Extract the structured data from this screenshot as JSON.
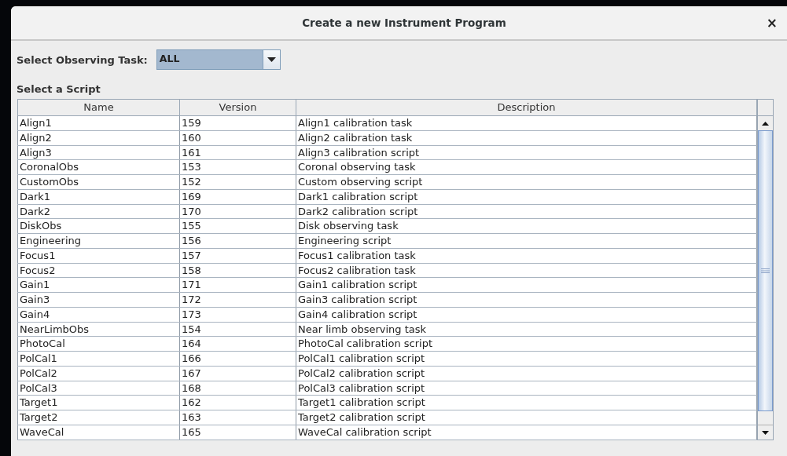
{
  "window": {
    "title": "Create a new Instrument Program",
    "close": "×"
  },
  "task": {
    "label": "Select Observing Task:",
    "value": "ALL"
  },
  "table": {
    "title": "Select a Script",
    "columns": [
      "Name",
      "Version",
      "Description"
    ],
    "rows": [
      [
        "Align1",
        "159",
        "Align1 calibration task"
      ],
      [
        "Align2",
        "160",
        "Align2 calibration task"
      ],
      [
        "Align3",
        "161",
        "Align3 calibration script"
      ],
      [
        "CoronalObs",
        "153",
        "Coronal observing task"
      ],
      [
        "CustomObs",
        "152",
        "Custom observing script"
      ],
      [
        "Dark1",
        "169",
        "Dark1 calibration script"
      ],
      [
        "Dark2",
        "170",
        "Dark2 calibration script"
      ],
      [
        "DiskObs",
        "155",
        "Disk observing task"
      ],
      [
        "Engineering",
        "156",
        "Engineering script"
      ],
      [
        "Focus1",
        "157",
        "Focus1 calibration task"
      ],
      [
        "Focus2",
        "158",
        "Focus2 calibration task"
      ],
      [
        "Gain1",
        "171",
        "Gain1 calibration script"
      ],
      [
        "Gain3",
        "172",
        "Gain3 calibration script"
      ],
      [
        "Gain4",
        "173",
        "Gain4 calibration script"
      ],
      [
        "NearLimbObs",
        "154",
        "Near limb observing task"
      ],
      [
        "PhotoCal",
        "164",
        "PhotoCal calibration script"
      ],
      [
        "PolCal1",
        "166",
        "PolCal1 calibration script"
      ],
      [
        "PolCal2",
        "167",
        "PolCal2 calibration script"
      ],
      [
        "PolCal3",
        "168",
        "PolCal3 calibration script"
      ],
      [
        "Target1",
        "162",
        "Target1 calibration script"
      ],
      [
        "Target2",
        "163",
        "Target2 calibration script"
      ],
      [
        "WaveCal",
        "165",
        "WaveCal calibration script"
      ]
    ]
  }
}
